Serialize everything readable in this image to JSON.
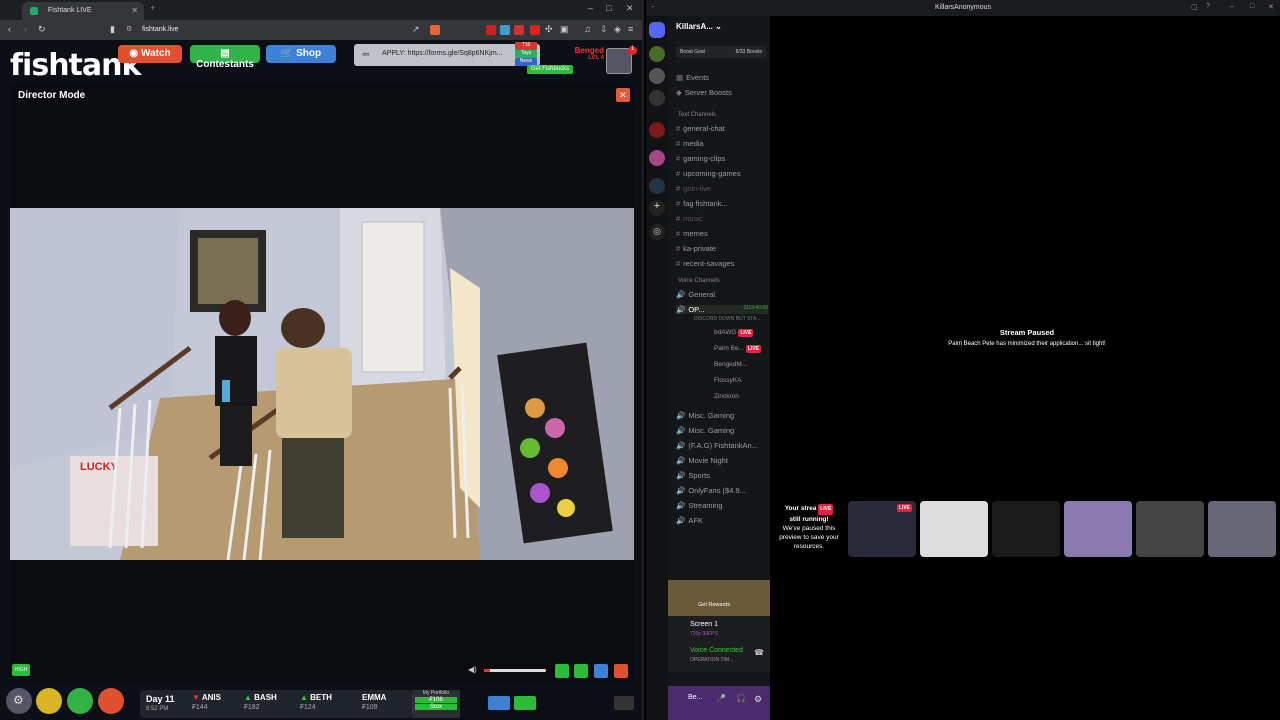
{
  "browser": {
    "tab_title": "Fishtank LIVE",
    "url": "fishtank.live"
  },
  "site": {
    "logo": "fishtank",
    "nav": {
      "watch": "Watch",
      "contestants": "Contestants",
      "shop": "Shop"
    },
    "apply_text": "APPLY: https://forms.gle/Sq8p6NKjm...",
    "mini_tags": [
      "T16",
      "Tays",
      "News"
    ],
    "get_fishbucks": "Get Fishbucks",
    "username": "Benged",
    "level": "LVL 4",
    "notif_count": "1"
  },
  "director": {
    "title": "Director Mode",
    "close": "✕",
    "quality": "HIGH"
  },
  "bottom": {
    "day": "Day 11",
    "time": "8:52 PM",
    "candidates": [
      {
        "name": "ANIS",
        "price": "₣144",
        "trend": "down"
      },
      {
        "name": "BASH",
        "price": "₣182",
        "trend": "up"
      },
      {
        "name": "BETH",
        "price": "₣124",
        "trend": "up"
      },
      {
        "name": "EMMA",
        "price": "₣109",
        "trend": "none"
      }
    ],
    "portfolio_label": "My Portfolio",
    "portfolio_value": "₣106",
    "stox": "Stox"
  },
  "discord": {
    "window_title": "KillarsAnonymous",
    "server_name": "KillarsA...",
    "boost_goal": "Boost Goal",
    "boost_count": "6/33 Boosts",
    "events": "Events",
    "server_boosts": "Server Boosts",
    "text_category": "Text Channels",
    "text_channels": [
      "general-chat",
      "media",
      "gaming-clips",
      "upcoming-games",
      "goin-live",
      "fag fishtank...",
      "music",
      "memes",
      "ka-private",
      "recent-savages"
    ],
    "voice_category": "Voice Channels",
    "voice_channels": [
      "General",
      "OP...",
      "Misc. Gaming",
      "Misc. Gaming",
      "(F.A.G) FishtankAn...",
      "Movie Night",
      "Sports",
      "OnlyFans ($4.9...",
      "Streaming",
      "AFK"
    ],
    "op_timer": "211d:40:00",
    "op_subtitle": "DISCORD DOWN BUT STA...",
    "voice_users": [
      "bdAWG",
      "Palm Be...",
      "BengedM...",
      "FlossyKA",
      "Zinckron"
    ],
    "live_label": "LIVE",
    "get_rewards": "Get Rewards",
    "screen_label": "Screen 1",
    "screen_sub": "720p 30FPS",
    "voice_connected": "Voice Connected",
    "voice_connected_sub": "OPERATION TIM...",
    "user_short": "Be...",
    "stream_paused": "Stream Paused",
    "stream_paused_sub": "Palm Beach Pete has minimized their application... sit tight!",
    "your_stream_1": "Your strea",
    "your_stream_2": "still running!",
    "your_stream_3": "We've paused this",
    "your_stream_4": "preview to save your",
    "your_stream_5": "resources."
  }
}
